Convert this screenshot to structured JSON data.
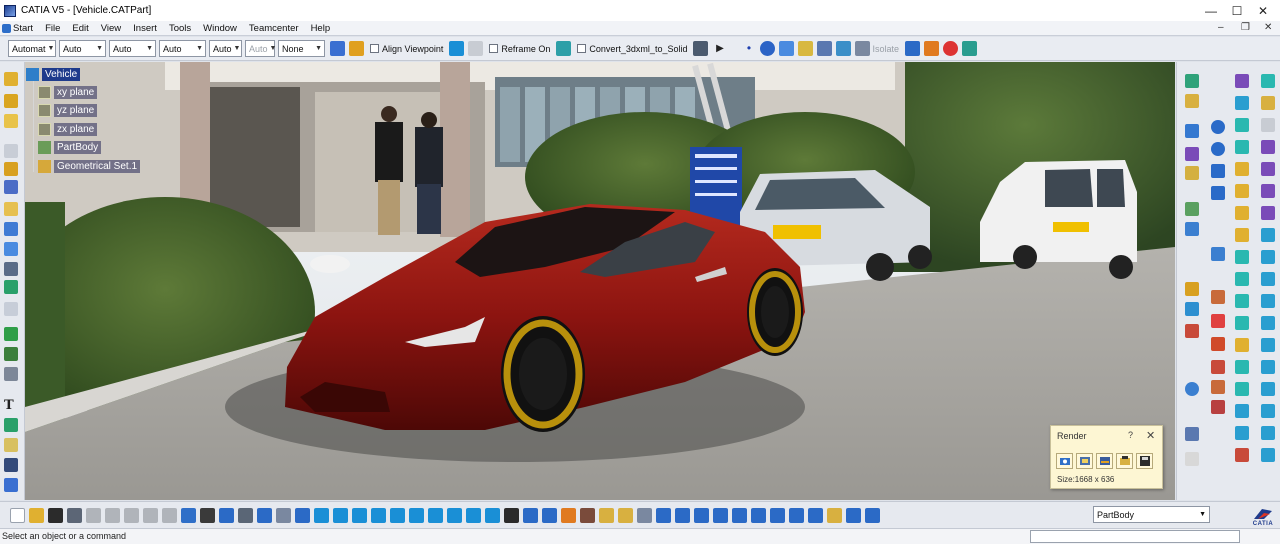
{
  "window": {
    "title": "CATIA V5 - [Vehicle.CATPart]",
    "controls": {
      "minimize": "—",
      "maximize": "☐",
      "close": "✕"
    }
  },
  "menu": {
    "items": [
      "Start",
      "File",
      "Edit",
      "View",
      "Insert",
      "Tools",
      "Window",
      "Teamcenter",
      "Help"
    ],
    "mdi_controls": [
      "–",
      "❐",
      "✕"
    ]
  },
  "toolbar": {
    "combos": [
      {
        "value": "Automat",
        "enabled": true
      },
      {
        "value": "Auto",
        "enabled": true
      },
      {
        "value": "Auto",
        "enabled": true
      },
      {
        "value": "Auto",
        "enabled": true
      },
      {
        "value": "Auto",
        "enabled": true
      },
      {
        "value": "Auto",
        "enabled": false
      },
      {
        "value": "None",
        "enabled": true
      }
    ],
    "align_viewpoint": "Align Viewpoint",
    "reframe_on": "Reframe On",
    "convert": "Convert_3dxml_to_Solid",
    "isolate": "Isolate"
  },
  "tree": {
    "root": "Vehicle",
    "children": [
      "xy plane",
      "yz plane",
      "zx plane",
      "PartBody",
      "Geometrical Set.1"
    ]
  },
  "scene": {
    "description_colors": {
      "car_body": "#8c1410",
      "rims": "#b8900c",
      "sky": "#e9eef2",
      "pavement": "#a6a49f"
    }
  },
  "render_panel": {
    "title": "Render",
    "help": "?",
    "close": "✕",
    "size": "Size:1668 x 636"
  },
  "bottom_toolbar": {
    "current_body": "PartBody"
  },
  "logo": {
    "text": "CATIA"
  },
  "status": {
    "message": "Select an object or a command"
  }
}
